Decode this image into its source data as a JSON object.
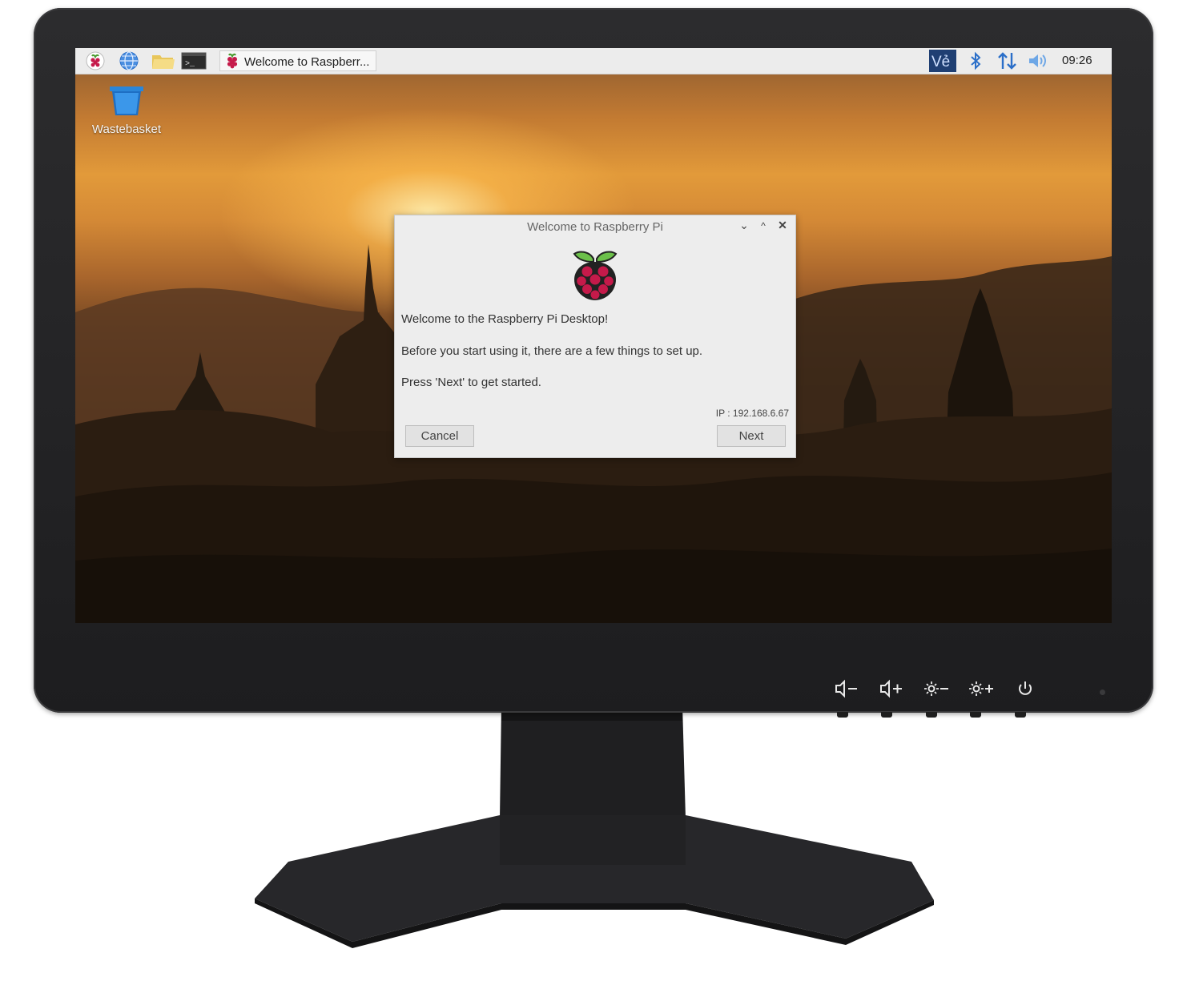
{
  "taskbar": {
    "icons": [
      "raspberry-menu-icon",
      "globe-browser-icon",
      "folder-icon",
      "terminal-icon"
    ],
    "active_task": "Welcome to Raspberr...",
    "tray": [
      "vnc-icon",
      "bluetooth-icon",
      "network-arrows-icon",
      "volume-icon"
    ],
    "clock": "09:26"
  },
  "desktop": {
    "wastebasket_label": "Wastebasket"
  },
  "dialog": {
    "title": "Welcome to Raspberry Pi",
    "line1": "Welcome to the Raspberry Pi Desktop!",
    "line2": "Before you start using it, there are a few things to set up.",
    "line3": "Press 'Next' to get started.",
    "ip": "IP : 192.168.6.67",
    "cancel_label": "Cancel",
    "next_label": "Next"
  },
  "monitor_controls": [
    "volume-down-icon",
    "volume-up-icon",
    "brightness-down-icon",
    "brightness-up-icon",
    "power-icon"
  ],
  "colors": {
    "bezel": "#2a2a2c",
    "taskbar": "#ececec",
    "dialog": "#ededed",
    "accent_blue": "#2b6fc9",
    "raspberry_red": "#c51a4a"
  }
}
